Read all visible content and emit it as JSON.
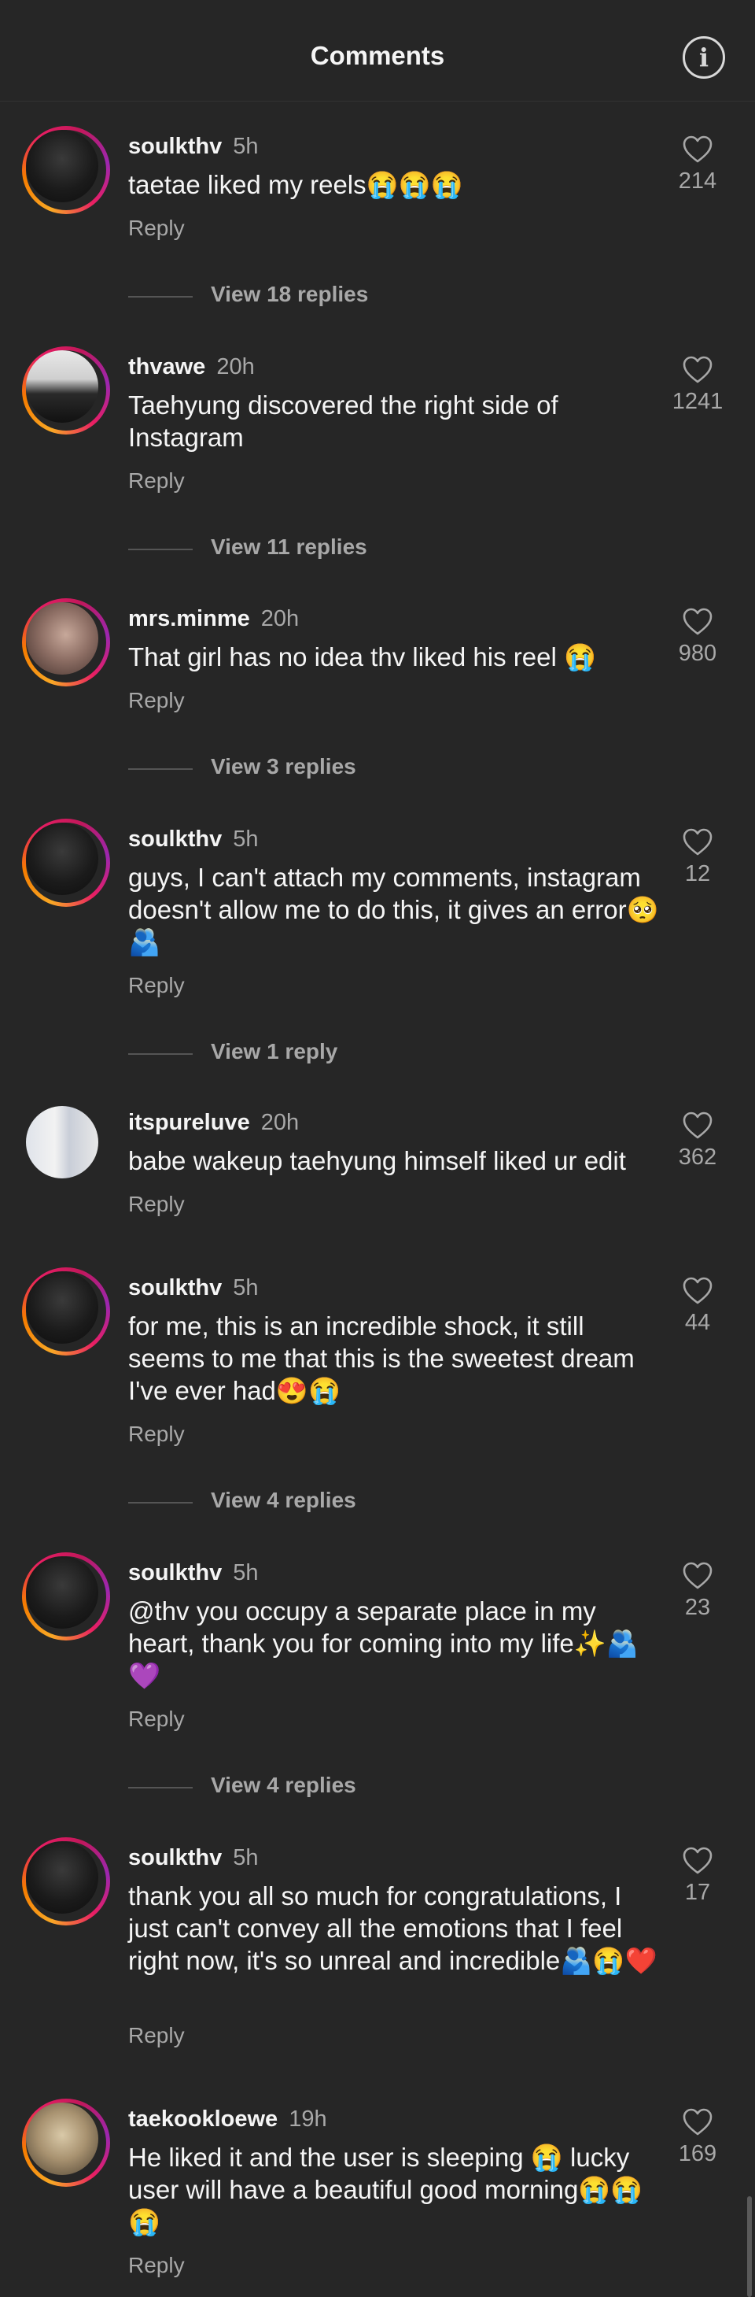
{
  "header": {
    "title": "Comments",
    "info_icon": "info-icon",
    "info_glyph": "i"
  },
  "comments": [
    {
      "user": "soulkthv",
      "time": "5h",
      "text": "taetae liked my reels😭😭😭",
      "likes": "214",
      "reply": "Reply",
      "view_replies": "View 18 replies"
    },
    {
      "user": "thvawe",
      "time": "20h",
      "text": "Taehyung discovered the right side of Instagram",
      "likes": "1241",
      "reply": "Reply",
      "view_replies": "View 11 replies"
    },
    {
      "user": "mrs.minme",
      "time": "20h",
      "text": "That girl has no idea thv liked his reel 😭",
      "likes": "980",
      "reply": "Reply",
      "view_replies": "View 3 replies"
    },
    {
      "user": "soulkthv",
      "time": "5h",
      "text": "guys, I can't attach my comments, instagram doesn't allow me to do this, it gives an error🥺🫂",
      "likes": "12",
      "reply": "Reply",
      "view_replies": "View 1 reply"
    },
    {
      "user": "itspureluve",
      "time": "20h",
      "text": "babe wakeup taehyung himself liked ur edit",
      "likes": "362",
      "reply": "Reply",
      "view_replies": ""
    },
    {
      "user": "soulkthv",
      "time": "5h",
      "text": "for me, this is an incredible shock, it still seems to me that this is the sweetest dream I've ever had😍😭",
      "likes": "44",
      "reply": "Reply",
      "view_replies": "View 4 replies"
    },
    {
      "user": "soulkthv",
      "time": "5h",
      "text": "@thv you occupy a separate place in my heart, thank you for coming into my life✨🫂💜",
      "likes": "23",
      "reply": "Reply",
      "view_replies": "View 4 replies"
    },
    {
      "user": "soulkthv",
      "time": "5h",
      "text": "thank you all so much for congratulations, I just can't convey all the emotions that I feel right now, it's so unreal and incredible🫂😭❤️",
      "likes": "17",
      "reply": "Reply",
      "view_replies": ""
    },
    {
      "user": "taekookloewe",
      "time": "19h",
      "text": "He liked it and the user is sleeping 😭 lucky user will have a beautiful good morning😭😭😭",
      "likes": "169",
      "reply": "Reply",
      "view_replies": ""
    }
  ],
  "colors": {
    "background": "#262626",
    "text": "#f5f5f5",
    "secondary": "#a8a8a8"
  }
}
